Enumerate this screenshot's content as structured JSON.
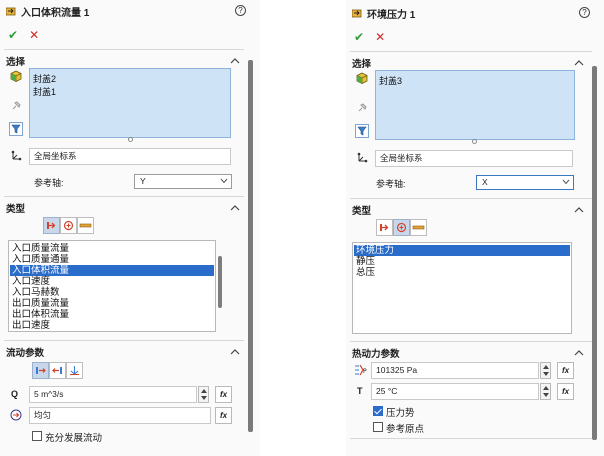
{
  "left": {
    "title": "入口体积流量 1",
    "help": "?",
    "ok": "✔",
    "cancel": "✕",
    "selection": {
      "header": "选择",
      "items": [
        "封盖2",
        "封盖1"
      ],
      "coord_system": "全局坐标系",
      "ref_axis_label": "参考轴:",
      "ref_axis_value": "Y"
    },
    "type": {
      "header": "类型",
      "list": [
        "入口质量流量",
        "入口质量通量",
        "入口体积流量",
        "入口速度",
        "入口马赫数",
        "出口质量流量",
        "出口体积流量",
        "出口速度"
      ],
      "selected_index": 2
    },
    "flow": {
      "header": "流动参数",
      "q_label": "Q",
      "q_value": "5 m^3/s",
      "uniform_value": "均匀",
      "fully_developed": "充分发展流动",
      "fully_developed_checked": false
    }
  },
  "right": {
    "title": "环境压力 1",
    "help": "?",
    "ok": "✔",
    "cancel": "✕",
    "selection": {
      "header": "选择",
      "items": [
        "封盖3"
      ],
      "coord_system": "全局坐标系",
      "ref_axis_label": "参考轴:",
      "ref_axis_value": "X"
    },
    "type": {
      "header": "类型",
      "list": [
        "环境压力",
        "静压",
        "总压"
      ],
      "selected_index": 0
    },
    "thermo": {
      "header": "热动力参数",
      "p_value": "101325 Pa",
      "t_label": "T",
      "t_value": "25 °C",
      "pressure_potential": "压力势",
      "pressure_potential_checked": true,
      "ref_origin": "参考原点",
      "ref_origin_checked": false
    }
  },
  "colors": {
    "accent": "#2a6cc9",
    "selection_bg": "#cfe3f6",
    "ok": "#2e9e3a",
    "cancel": "#d22a2a"
  }
}
